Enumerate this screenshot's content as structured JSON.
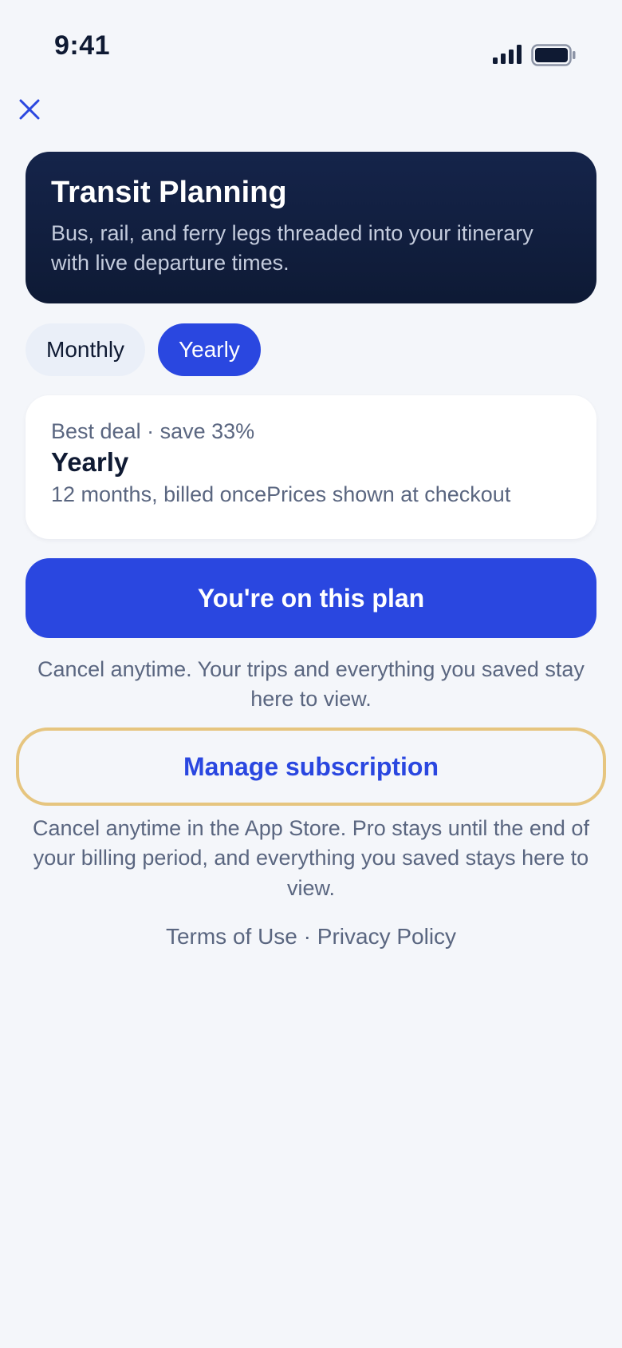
{
  "status_bar": {
    "time": "9:41"
  },
  "header": {
    "close_icon": "close-icon"
  },
  "hero": {
    "title": "Transit Planning",
    "subtitle": "Bus, rail, and ferry legs threaded into your itinerary with live departure times."
  },
  "plan_toggle": {
    "options": [
      {
        "label": "Monthly",
        "selected": false
      },
      {
        "label": "Yearly",
        "selected": true
      }
    ]
  },
  "plan_card": {
    "tag": "Best deal · save 33%",
    "name": "Yearly",
    "description": "12 months, billed oncePrices shown at checkout"
  },
  "primary_button": {
    "label": "You're on this plan"
  },
  "note_current": "Cancel anytime. Your trips and everything you saved stay here to view.",
  "manage_button": {
    "label": "Manage subscription"
  },
  "note_app_store": "Cancel anytime in the App Store. Pro stays until the end of your billing period, and everything you saved stays here to view.",
  "legal": {
    "terms": "Terms of Use",
    "separator": " · ",
    "privacy": "Privacy Policy"
  },
  "colors": {
    "background": "#F4F6FA",
    "accent": "#2A47E0",
    "hero_bg": "#0E1A35",
    "focus_ring": "#E6C57F",
    "muted_text": "#5A6680"
  }
}
